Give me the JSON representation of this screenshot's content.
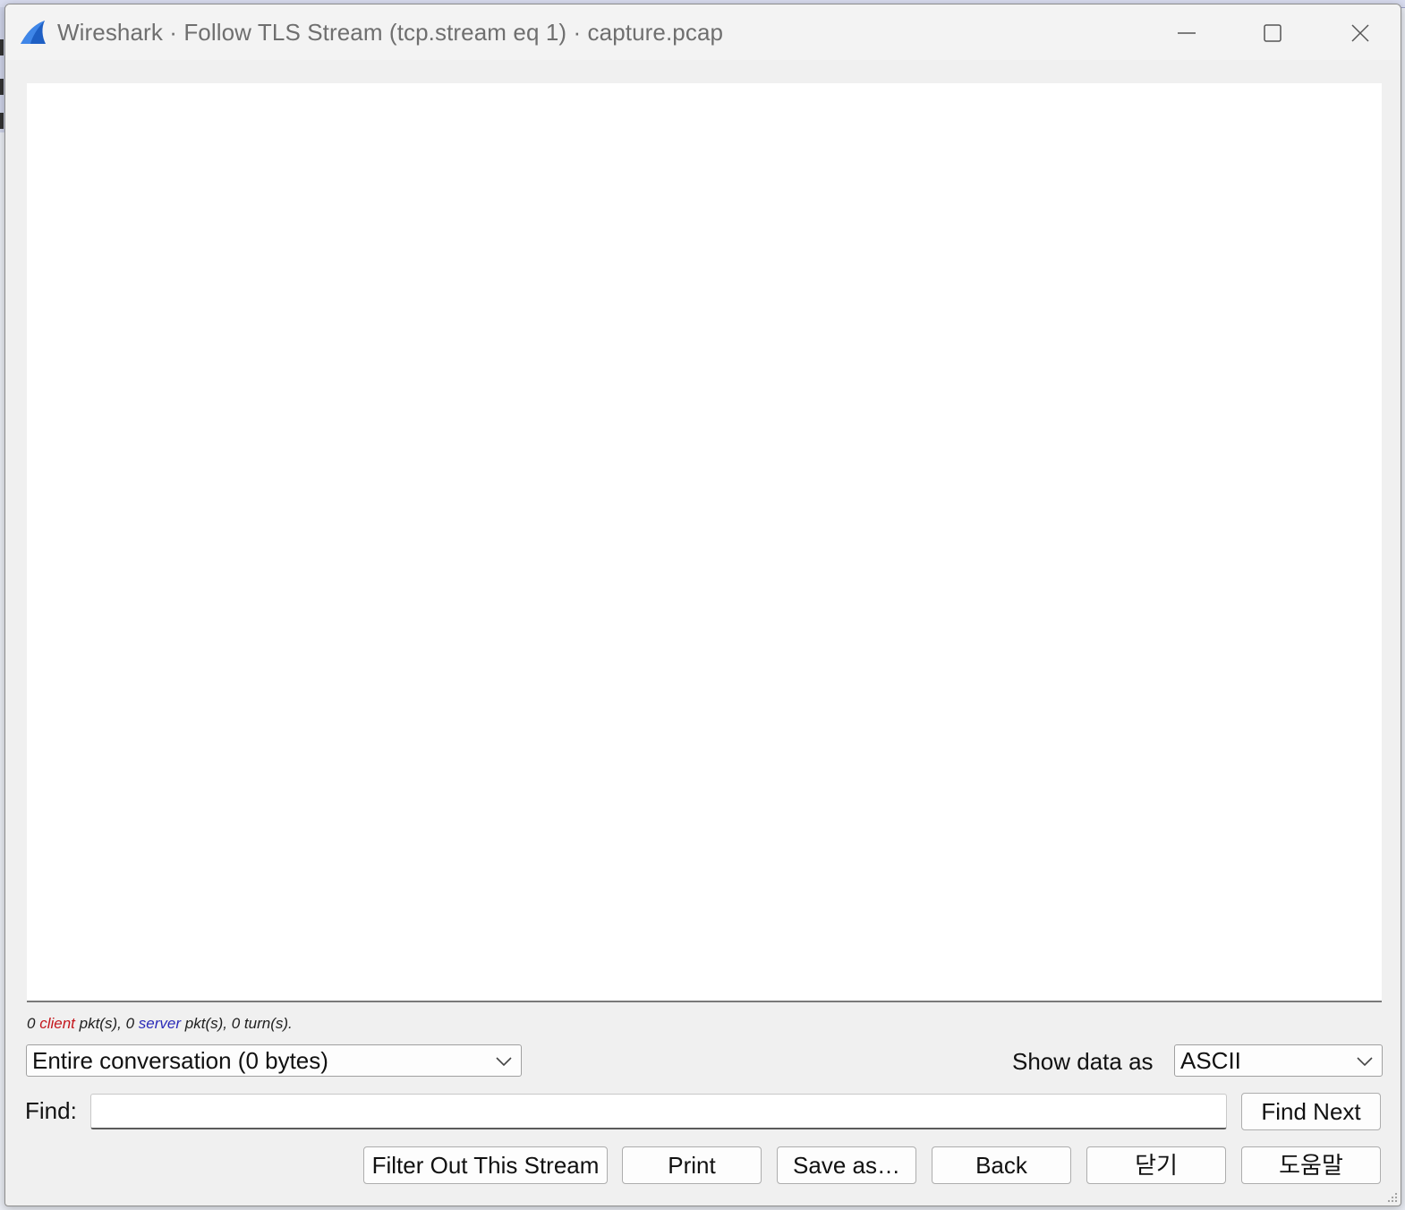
{
  "window": {
    "title": "Wireshark · Follow TLS Stream (tcp.stream eq 1) · capture.pcap"
  },
  "stats": {
    "client_count": "0",
    "client_word": "client",
    "client_suffix": "pkt(s),",
    "server_count": "0",
    "server_word": "server",
    "server_suffix": "pkt(s),",
    "turns": "0 turn(s)."
  },
  "conversation_select": {
    "value": "Entire conversation (0 bytes)"
  },
  "show_data": {
    "label": "Show data as",
    "value": "ASCII"
  },
  "find": {
    "label": "Find:",
    "value": "",
    "next_label": "Find Next"
  },
  "buttons": {
    "filter_out": "Filter Out This Stream",
    "print": "Print",
    "save_as": "Save as…",
    "back": "Back",
    "close": "닫기",
    "help": "도움말"
  },
  "colors": {
    "client": "#c4161c",
    "server": "#2b2bb8",
    "app_icon": "#1e5fc4"
  },
  "icons": [
    "wireshark-fin-icon",
    "minimize-icon",
    "maximize-icon",
    "close-icon",
    "chevron-down-icon",
    "resize-grip-icon"
  ]
}
